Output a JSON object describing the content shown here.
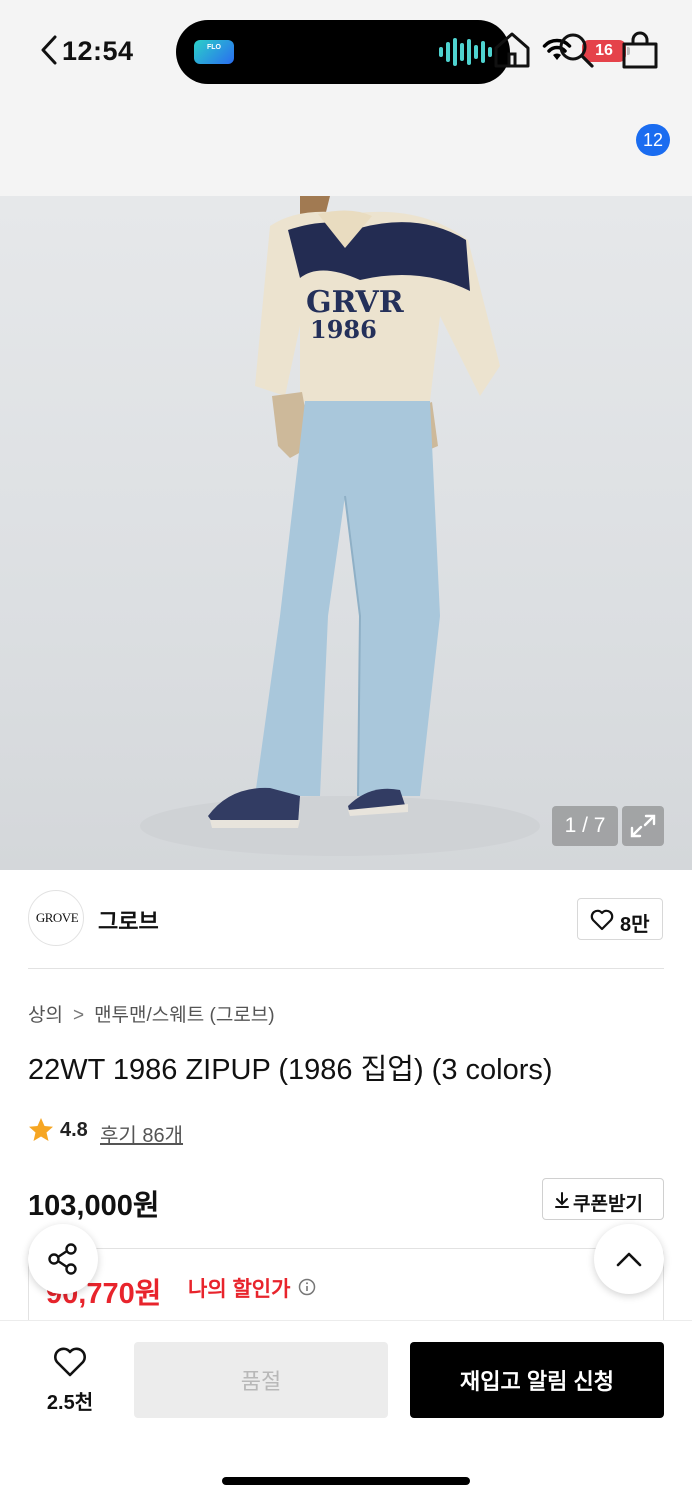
{
  "status_bar": {
    "time": "12:54",
    "battery": "16",
    "colors": {
      "battery": "#e5424a"
    }
  },
  "nav": {
    "back_icon": "chevron-left-icon",
    "home_icon": "home-icon",
    "search_icon": "search-icon",
    "cart_icon": "shopping-bag-icon",
    "cart_count": "12"
  },
  "gallery": {
    "counter": "1 / 7",
    "expand_icon": "expand-icon"
  },
  "brand": {
    "logo_text": "GROVE",
    "name": "그로브",
    "likes": "8만"
  },
  "product": {
    "breadcrumb": [
      "상의",
      "맨투맨/스웨트 (그로브)"
    ],
    "title": "22WT 1986 ZIPUP (1986 집업) (3 colors)",
    "rating": "4.8",
    "reviews": "후기 86개",
    "price": "103,000원",
    "coupon_label": "쿠폰받기",
    "discount_price": "90,770원",
    "discount_label": "나의 할인가"
  },
  "floating": {
    "share_icon": "share-icon",
    "top_icon": "chevron-up-icon"
  },
  "bottom_bar": {
    "wish_count": "2.5천",
    "soldout_label": "품절",
    "restock_label": "재입고 알림 신청"
  },
  "colors": {
    "accent_red": "#e8242c",
    "badge_blue": "#1a6cf0",
    "star": "#f6a623"
  }
}
